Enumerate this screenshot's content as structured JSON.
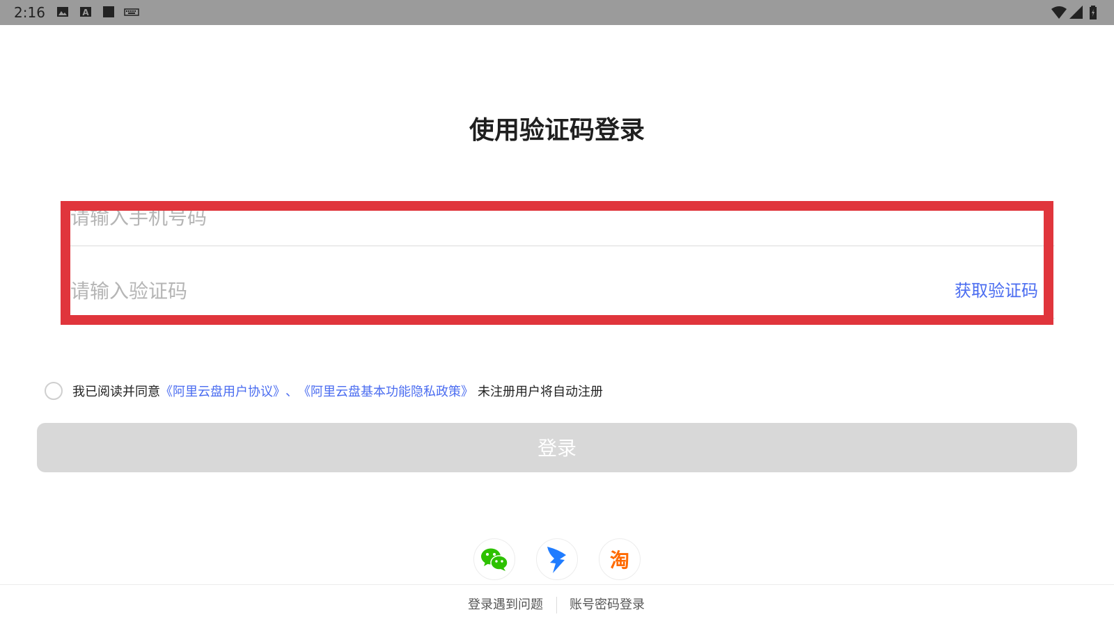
{
  "status_bar": {
    "time": "2:16",
    "left_icons": [
      "image-icon",
      "a-box-icon",
      "square-icon",
      "keyboard-icon"
    ],
    "right_icons": [
      "wifi-icon",
      "signal-icon",
      "battery-icon"
    ]
  },
  "page": {
    "title": "使用验证码登录"
  },
  "form": {
    "phone_placeholder": "请输入手机号码",
    "code_placeholder": "请输入验证码",
    "get_code_label": "获取验证码"
  },
  "agreement": {
    "prefix": "我已阅读并同意",
    "user_agreement": "《阿里云盘用户协议》",
    "separator": "、",
    "privacy_policy": "《阿里云盘基本功能隐私政策》",
    "suffix": "未注册用户将自动注册"
  },
  "login_button": {
    "label": "登录"
  },
  "third_party": {
    "taobao_glyph": "淘"
  },
  "footer": {
    "problem_label": "登录遇到问题",
    "password_login_label": "账号密码登录"
  },
  "colors": {
    "highlight": "#e0353c",
    "link": "#4a6cf0",
    "button_disabled": "#d8d8d8",
    "wechat": "#2dc100",
    "dingtalk": "#1f7cff",
    "taobao": "#ff6a00"
  }
}
